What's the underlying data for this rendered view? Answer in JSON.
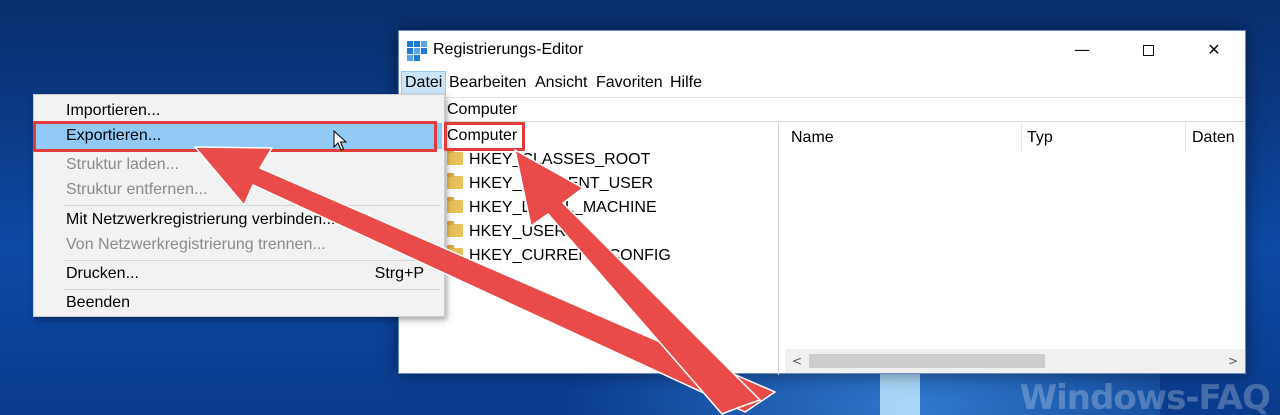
{
  "window": {
    "title": "Registrierungs-Editor",
    "min_glyph": "—",
    "close_glyph": "✕"
  },
  "menubar": [
    "Datei",
    "Bearbeiten",
    "Ansicht",
    "Favoriten",
    "Hilfe"
  ],
  "address": "Computer",
  "tree": {
    "root": "Computer",
    "nodes": [
      "HKEY_CLASSES_ROOT",
      "HKEY_CURRENT_USER",
      "HKEY_LOCAL_MACHINE",
      "HKEY_USERS",
      "HKEY_CURRENT_CONFIG"
    ]
  },
  "list_columns": [
    "Name",
    "Typ",
    "Daten"
  ],
  "scroll": {
    "left_arrow": "<",
    "right_arrow": ">"
  },
  "file_menu": {
    "items": [
      {
        "label": "Importieren...",
        "enabled": true
      },
      {
        "label": "Exportieren...",
        "enabled": true,
        "highlighted": true
      },
      {
        "label": "Struktur laden...",
        "enabled": false
      },
      {
        "label": "Struktur entfernen...",
        "enabled": false
      },
      {
        "label": "Mit Netzwerkregistrierung verbinden...",
        "enabled": true
      },
      {
        "label": "Von Netzwerkregistrierung trennen...",
        "enabled": false
      },
      {
        "label": "Drucken...",
        "enabled": true,
        "shortcut": "Strg+P"
      },
      {
        "label": "Beenden",
        "enabled": true
      }
    ]
  },
  "watermark": "Windows-FAQ",
  "colors": {
    "annotation_red": "#e23b3b",
    "menu_highlight": "#91c9f7",
    "folder": "#e8c05a",
    "desktop_blue": "#0b3a86"
  }
}
